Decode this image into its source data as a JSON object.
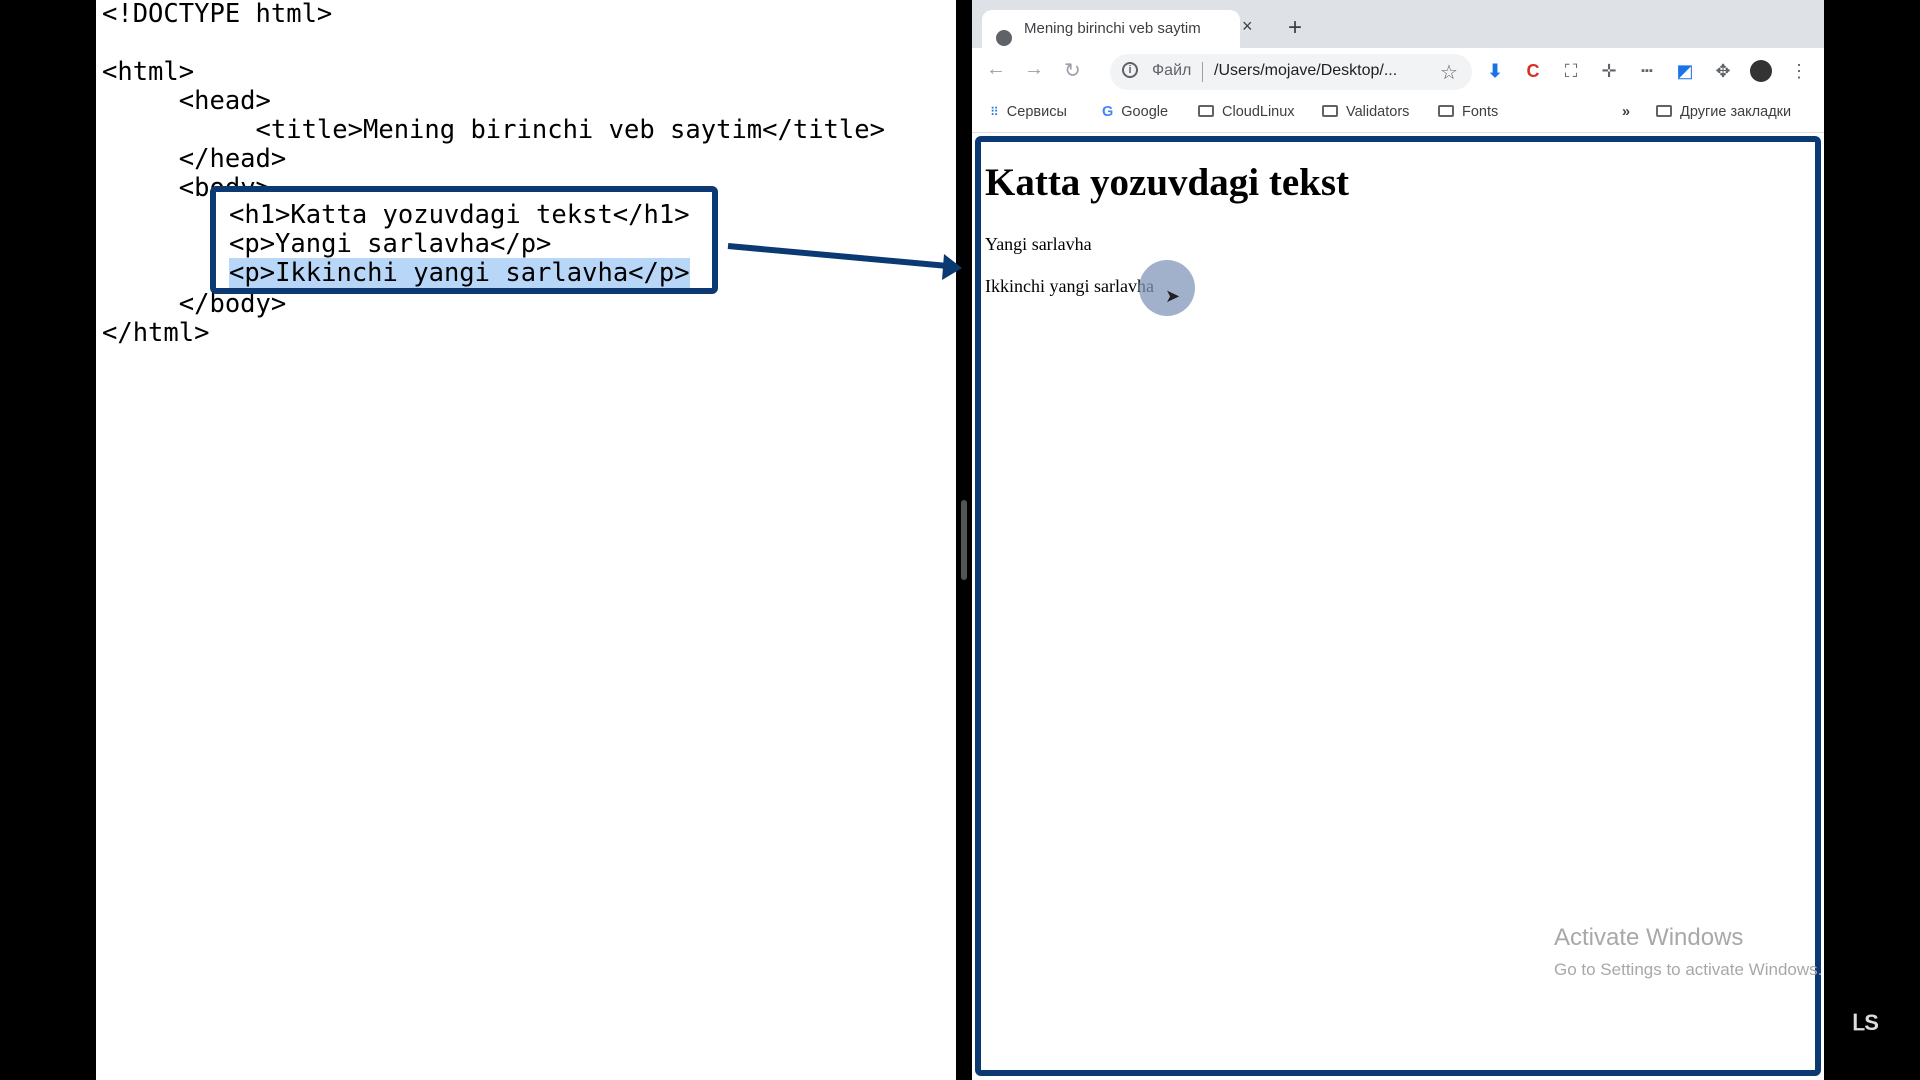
{
  "editor": {
    "lines": [
      "<!DOCTYPE html>",
      "",
      "<html>",
      "     <head>",
      "          <title>Mening birinchi veb saytim</title>",
      "     </head>",
      "     <body>",
      "",
      "",
      "",
      "     </body>",
      "</html>"
    ],
    "callout_lines": [
      "<h1>Katta yozuvdagi tekst</h1>",
      "<p>Yangi sarlavha</p>",
      "Ikkinchi yangi sarlavha</p>"
    ],
    "callout_line3_prefix": "<p>"
  },
  "browser": {
    "tab_title": "Mening birinchi veb saytim",
    "tab_close": "×",
    "new_tab": "+",
    "nav": {
      "back": "←",
      "forward": "→",
      "reload": "↻"
    },
    "omnibox": {
      "scheme": "Файл",
      "url": "/Users/mojave/Desktop/...",
      "info": "i",
      "star": "☆"
    },
    "extensions": [
      "download-icon",
      "c-extension-icon",
      "screenshot-icon",
      "ruler-icon",
      "wifi-icon",
      "translate-icon",
      "puzzle-icon",
      "profile-icon",
      "menu-icon"
    ],
    "bookmarks": {
      "apps": "Сервисы",
      "items": [
        "Google",
        "CloudLinux",
        "Validators",
        "Fonts"
      ],
      "more": "»",
      "other": "Другие закладки"
    },
    "page": {
      "h1": "Katta yozuvdagi tekst",
      "p1": "Yangi sarlavha",
      "p2": "Ikkinchi yangi sarlavha"
    }
  },
  "watermark": {
    "title": "Activate Windows",
    "subtitle": "Go to Settings to activate Windows."
  },
  "logo": "ᒪS",
  "colors": {
    "accent": "#0b3a73",
    "selection": "#b8d6f7"
  }
}
